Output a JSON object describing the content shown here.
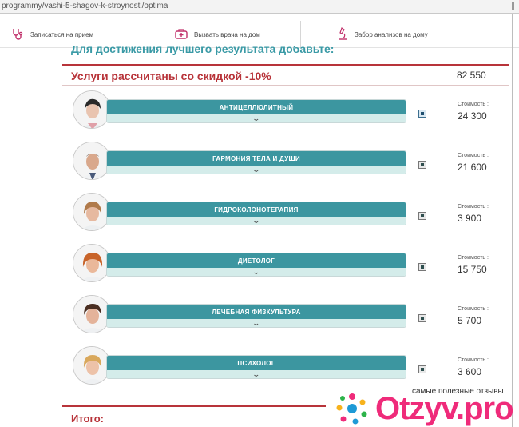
{
  "browser": {
    "url": "programmy/vashi-5-shagov-k-stroynosti/optima"
  },
  "topnav": {
    "items": [
      {
        "label": "Записаться на прием",
        "icon": "stethoscope-icon"
      },
      {
        "label": "Вызвать врача на дом",
        "icon": "medical-bag-icon"
      },
      {
        "label": "Забор анализов на дому",
        "icon": "microscope-icon"
      }
    ]
  },
  "promo": {
    "heading": "Для достижения лучшего результата добавьте:"
  },
  "discount": {
    "label": "Услуги рассчитаны со скидкой -10%",
    "total": "82 550"
  },
  "services": [
    {
      "name": "АНТИЦЕЛЛЮЛИТНЫЙ",
      "price_label": "Стоимость :",
      "price": "24 300",
      "checked": true
    },
    {
      "name": "ГАРМОНИЯ ТЕЛА И ДУШИ",
      "price_label": "Стоимость :",
      "price": "21 600",
      "checked": true
    },
    {
      "name": "ГИДРОКОЛОНОТЕРАПИЯ",
      "price_label": "Стоимость :",
      "price": "3 900",
      "checked": true
    },
    {
      "name": "ДИЕТОЛОГ",
      "price_label": "Стоимость :",
      "price": "15 750",
      "checked": true
    },
    {
      "name": "ЛЕЧЕБНАЯ ФИЗКУЛЬТУРА",
      "price_label": "Стоимость :",
      "price": "5 700",
      "checked": true
    },
    {
      "name": "ПСИХОЛОГ",
      "price_label": "Стоимость :",
      "price": "3 600",
      "checked": true
    }
  ],
  "total": {
    "label": "Итого:"
  },
  "watermark": {
    "caption": "самые полезные отзывы",
    "brand": "Otzyv.pro"
  },
  "colors": {
    "accent": "#3c96a0",
    "bar_light": "#d4ecea",
    "discount_red": "#b8343a",
    "brand_pink": "#ef2b7a"
  }
}
